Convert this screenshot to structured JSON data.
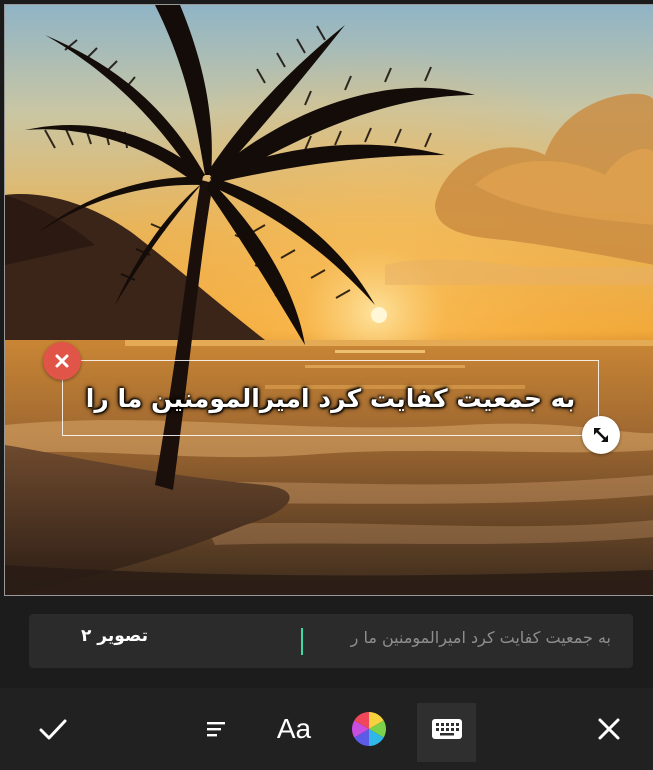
{
  "overlay": {
    "text": "به جمعیت کفایت کرد امیرالمومنین ما را"
  },
  "text_input": {
    "value": "به جمعیت کفایت کرد امیرالمومنین ما ر"
  },
  "layer": {
    "name": "تصویر ۲"
  },
  "toolbar": {
    "confirm_icon": "checkmark-icon",
    "align_icon": "align-right-icon",
    "font_label": "Aa",
    "color_icon": "color-wheel-icon",
    "keyboard_icon": "keyboard-icon",
    "close_icon": "close-icon"
  },
  "colors": {
    "delete_button": "#e05548",
    "caret": "#3dd9a3",
    "toolbar_bg": "#212121",
    "input_bg": "#2b2b2b"
  }
}
